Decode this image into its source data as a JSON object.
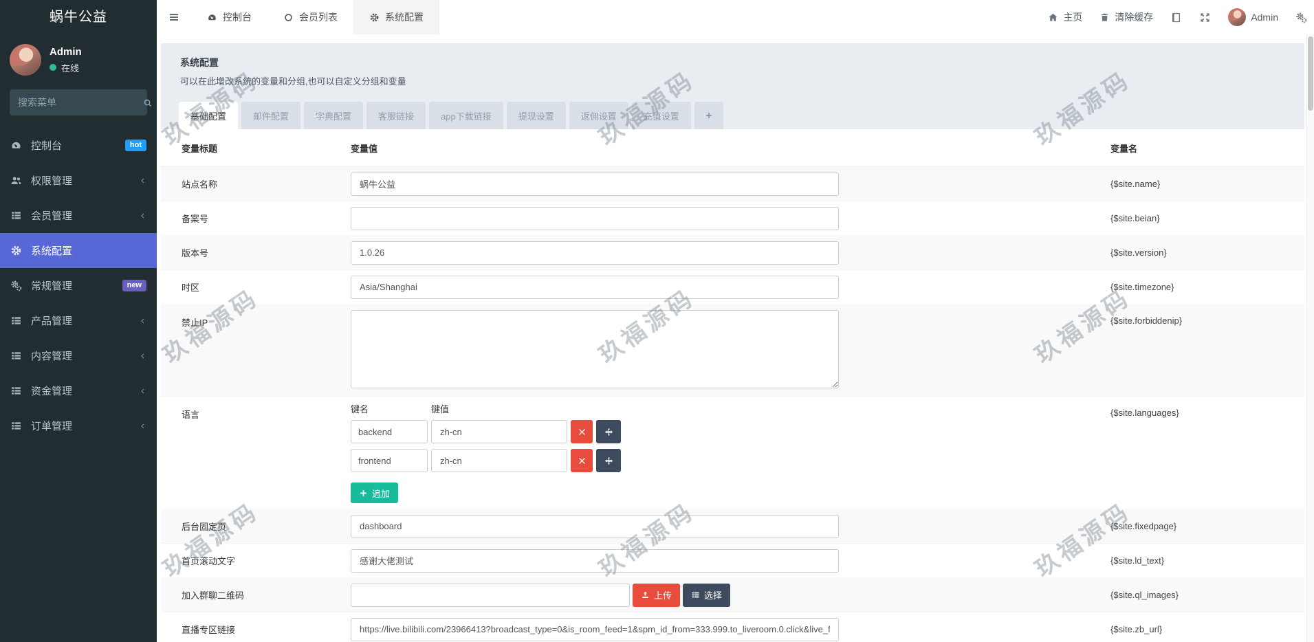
{
  "sidebar": {
    "logo": "蜗牛公益",
    "user": {
      "name": "Admin",
      "status": "在线"
    },
    "search_placeholder": "搜索菜单",
    "menu": [
      {
        "label": "控制台",
        "icon": "tachometer",
        "badge": "hot",
        "badge_color": "#1e9fff"
      },
      {
        "label": "权限管理",
        "icon": "users",
        "chevron": true
      },
      {
        "label": "会员管理",
        "icon": "thlist",
        "chevron": true
      },
      {
        "label": "系统配置",
        "icon": "gear",
        "active": true
      },
      {
        "label": "常规管理",
        "icon": "gears",
        "badge": "new",
        "badge_color": "#6a5fc1"
      },
      {
        "label": "产品管理",
        "icon": "thlist",
        "chevron": true
      },
      {
        "label": "内容管理",
        "icon": "thlist",
        "chevron": true
      },
      {
        "label": "资金管理",
        "icon": "thlist",
        "chevron": true
      },
      {
        "label": "订单管理",
        "icon": "thlist",
        "chevron": true
      }
    ]
  },
  "topbar": {
    "tabs": [
      {
        "label": "控制台",
        "icon": "tachometer"
      },
      {
        "label": "会员列表",
        "icon": "circleo"
      },
      {
        "label": "系统配置",
        "icon": "gear",
        "active": true
      }
    ],
    "home_label": "主页",
    "clear_cache_label": "清除缓存",
    "username": "Admin"
  },
  "page": {
    "title": "系统配置",
    "subtitle": "可以在此增改系统的变量和分组,也可以自定义分组和变量"
  },
  "config_tabs": [
    "基础配置",
    "邮件配置",
    "字典配置",
    "客服链接",
    "app下载链接",
    "提现设置",
    "返佣设置",
    "充值设置"
  ],
  "table": {
    "headers": [
      "变量标题",
      "变量值",
      "变量名"
    ],
    "rows": [
      {
        "label": "站点名称",
        "type": "input",
        "value": "蜗牛公益",
        "var": "{$site.name}"
      },
      {
        "label": "备案号",
        "type": "input",
        "value": "",
        "var": "{$site.beian}"
      },
      {
        "label": "版本号",
        "type": "input",
        "value": "1.0.26",
        "var": "{$site.version}"
      },
      {
        "label": "时区",
        "type": "input",
        "value": "Asia/Shanghai",
        "var": "{$site.timezone}"
      },
      {
        "label": "禁止IP",
        "type": "textarea",
        "value": "",
        "var": "{$site.forbiddenip}"
      },
      {
        "label": "语言",
        "type": "language",
        "value": "",
        "var": "{$site.languages}"
      },
      {
        "label": "后台固定页",
        "type": "input",
        "value": "dashboard",
        "var": "{$site.fixedpage}"
      },
      {
        "label": "首页滚动文字",
        "type": "input",
        "value": "感谢大佬测试",
        "var": "{$site.ld_text}"
      },
      {
        "label": "加入群聊二维码",
        "type": "image",
        "value": "",
        "var": "{$site.ql_images}"
      },
      {
        "label": "直播专区链接",
        "type": "input",
        "value": "https://live.bilibili.com/23966413?broadcast_type=0&is_room_feed=1&spm_id_from=333.999.to_liveroom.0.click&live_f",
        "var": "{$site.zb_url}"
      }
    ]
  },
  "language_editor": {
    "key_header": "键名",
    "value_header": "键值",
    "pairs": [
      {
        "key": "backend",
        "value": "zh-cn"
      },
      {
        "key": "frontend",
        "value": "zh-cn"
      }
    ],
    "append_label": "追加"
  },
  "image_row": {
    "upload_label": "上传",
    "choose_label": "选择"
  },
  "watermark_text": "玖福源码",
  "colors": {
    "sidebar_active": "#5867d6",
    "badge_hot": "#1e9fff",
    "badge_new": "#6a5fc1",
    "danger": "#e74c3c",
    "dark_button": "#3e4b5e",
    "success": "#18bc9c"
  }
}
